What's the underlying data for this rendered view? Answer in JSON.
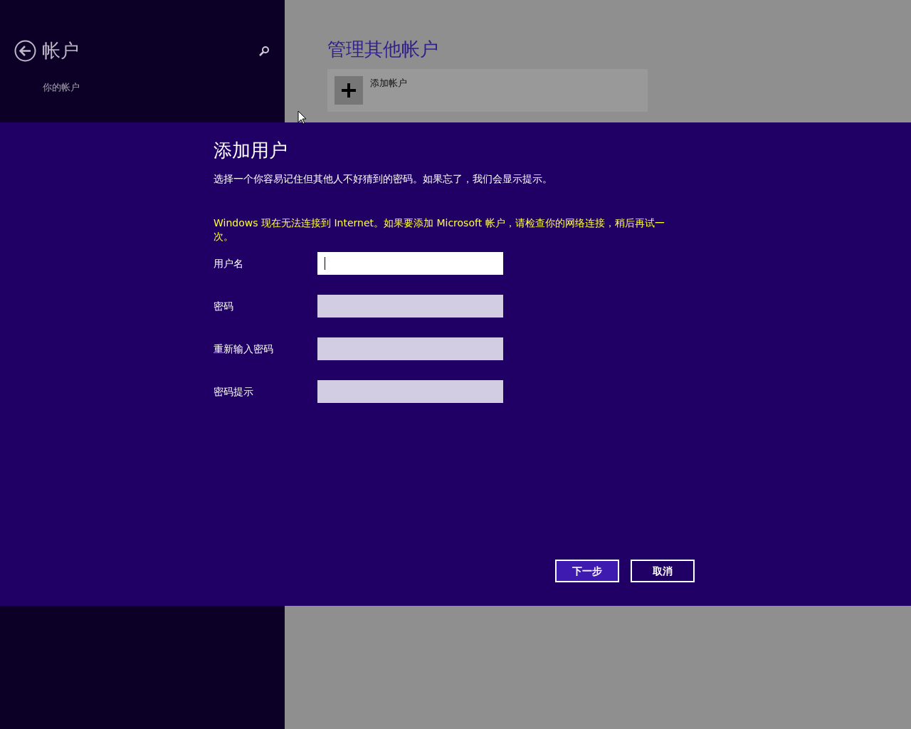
{
  "sidebar": {
    "title": "帐户",
    "items": [
      {
        "label": "你的帐户"
      }
    ]
  },
  "page": {
    "title": "管理其他帐户",
    "tiles": [
      {
        "label": "添加帐户"
      }
    ]
  },
  "dialog": {
    "title": "添加用户",
    "description": "选择一个你容易记住但其他人不好猜到的密码。如果忘了，我们会显示提示。",
    "warning": "Windows 现在无法连接到 Internet。如果要添加 Microsoft 帐户，请检查你的网络连接，稍后再试一次。",
    "fields": [
      {
        "label": "用户名",
        "focused": true
      },
      {
        "label": "密码",
        "focused": false
      },
      {
        "label": "重新输入密码",
        "focused": false
      },
      {
        "label": "密码提示",
        "focused": false
      }
    ],
    "buttons": [
      {
        "label": "下一步",
        "kind": "primary"
      },
      {
        "label": "取消",
        "kind": "secondary"
      }
    ]
  }
}
